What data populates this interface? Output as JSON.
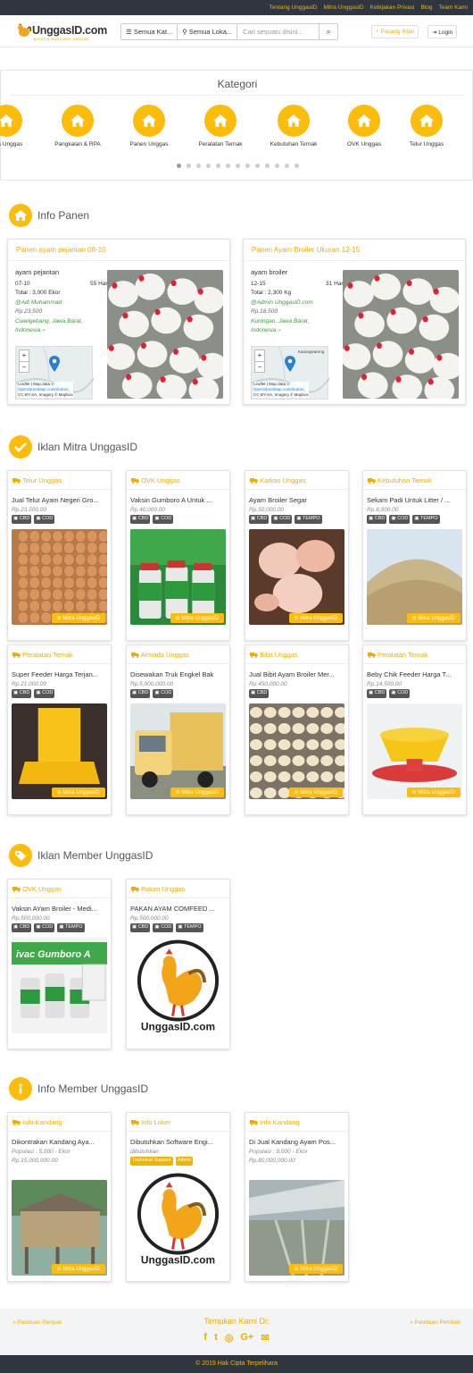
{
  "topnav": [
    "Tentang UnggasID",
    "Mitra UnggasID",
    "Kebijakan Privasi",
    "Blog",
    "Team Kami"
  ],
  "brand": {
    "name": "UnggasID.com",
    "tagline": "poultry business partner"
  },
  "search": {
    "category": "Semua Kat...",
    "location": "Semua Loka...",
    "placeholder": "Cari sesuatu disini..."
  },
  "header_buttons": {
    "post": "Pasang Iklan",
    "login": "Login"
  },
  "kategori": {
    "title": "Kategori",
    "items": [
      "rkas Unggas",
      "Pangkalan & RPA",
      "Panen Unggas",
      "Peralatan Ternak",
      "Kebutuhan Ternak",
      "OVK Unggas",
      "Telur Unggas"
    ]
  },
  "sections": {
    "panen": "Info Panen",
    "mitra": "Iklan Mitra UnggasID",
    "member": "Iklan Member UnggasID",
    "info_member": "Info Member UnggasID"
  },
  "panen": [
    {
      "title": "Panen ayam pejantan 08-10",
      "type": "ayam pejantan",
      "age": "07-10",
      "days": "55 Hari",
      "total": "Total : 3,000 Ekor",
      "user": "@Adi Muhammad",
      "price": "Rp.23,500",
      "loc1": "Ciawigebang, Jawa Barat,",
      "loc2": "Indonesia"
    },
    {
      "title": "Panen Ayam Broiler Ukuran 12-15",
      "type": "ayam broiler",
      "age": "12-15",
      "days": "31 Hari",
      "total": "Total : 2,300 Kg",
      "user": "@Admin UnggasID.com",
      "price": "Rp.18,500",
      "loc1": "Kuningan, Jawa Barat,",
      "loc2": "Indonesia"
    }
  ],
  "map": {
    "zoom_in": "+",
    "zoom_out": "−",
    "attr1": "Leaflet | Map data ©",
    "attr2": "OpenStreetMap contributors,",
    "attr3": "CC-BY-SA, Imagery © Mapbox",
    "place": "Karangwareng"
  },
  "mitra_badge": "Mitra UnggasID",
  "mitra_ads": [
    {
      "cat": "Telur Unggas",
      "title": "Jual Telur Ayam Negeri Gro...",
      "price": "Rp.23,500.00",
      "tags": [
        "CBD",
        "COD"
      ]
    },
    {
      "cat": "OVK Unggas",
      "title": "Vaksin Gumboro A Untuk ...",
      "price": "Rp.40,000.00",
      "tags": [
        "CBD",
        "COD"
      ]
    },
    {
      "cat": "Karkas Unggas",
      "title": "Ayam Broiler Segar",
      "price": "Rp.50,000.00",
      "tags": [
        "CBD",
        "COD",
        "TEMPO"
      ]
    },
    {
      "cat": "Kebutuhan Ternak",
      "title": "Sekam Padi Untuk Litter / ...",
      "price": "Rp.8,000.00",
      "tags": [
        "CBD",
        "COD",
        "TEMPO"
      ]
    },
    {
      "cat": "Peralatan Ternak",
      "title": "Super Feeder Harga Terjan...",
      "price": "Rp.21,000.00",
      "tags": [
        "CBD",
        "COD"
      ]
    },
    {
      "cat": "Armada Unggas",
      "title": "Disewakan Truk Engkel Bak",
      "price": "Rp.5,000,000.00",
      "tags": [
        "CBD",
        "COD"
      ]
    },
    {
      "cat": "Bibit Unggas",
      "title": "Jual Bibit Ayam Broiler Mer...",
      "price": "Rp.450,000.00",
      "tags": [
        "CBD"
      ]
    },
    {
      "cat": "Peralatan Ternak",
      "title": "Beby Chik Feeder Harga T...",
      "price": "Rp.14,500.00",
      "tags": [
        "CBD",
        "COD"
      ]
    }
  ],
  "member_ads": [
    {
      "cat": "OVK Unggas",
      "title": "Vaksin AYam Broiler - Medi...",
      "price": "Rp.500,000.00",
      "tags": [
        "CBD",
        "COD",
        "TEMPO"
      ],
      "label": "ivac Gumboro A"
    },
    {
      "cat": "Pakan Unggas",
      "title": "PAKAN AYAM COMFEED ...",
      "price": "Rp.500,000.00",
      "tags": [
        "CBD",
        "COD",
        "TEMPO"
      ],
      "logo": "UnggasID.com"
    }
  ],
  "info_member": [
    {
      "cat": "Info Kandang",
      "title": "Dikontrakan Kandang Aya...",
      "sub": "Populasi : 5,000 - Ekor",
      "price": "Rp.15,000,000.00"
    },
    {
      "cat": "Info Loker",
      "title": "Dibutuhkan Software Engi...",
      "sub": "dibutuhkan",
      "tags": [
        "Technical Support",
        "Admin"
      ],
      "logo": "UnggasID.com"
    },
    {
      "cat": "Info Kandang",
      "title": "Di Jual Kandang Ayam Pos...",
      "sub": "Populasi : 9,000 - Ekor",
      "price": "Rp.80,000,000.00"
    }
  ],
  "footer": {
    "left": "» Panduan Penjual",
    "center": "Temukan Kami Di:",
    "right": "» Panduan Pembeli",
    "social": [
      "f",
      "t",
      "◎",
      "G+",
      "✉"
    ],
    "copyright": "© 2019 Hak Cipta Terpelihara"
  },
  "colors": {
    "accent": "#fcbc0b",
    "dark": "#2f3640"
  }
}
